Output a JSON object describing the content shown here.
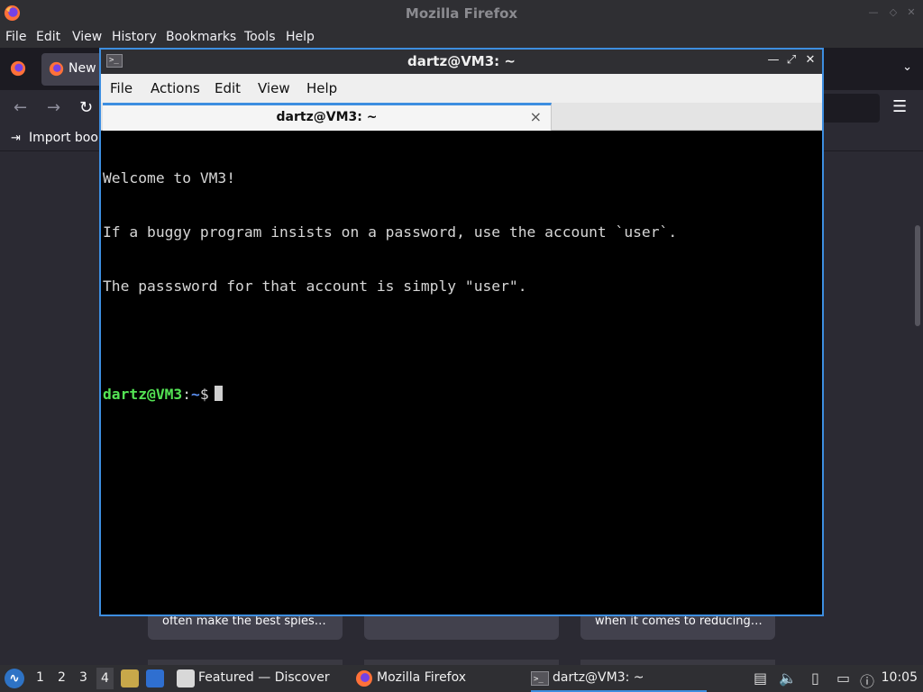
{
  "firefox": {
    "window_title": "Mozilla Firefox",
    "menu": [
      "File",
      "Edit",
      "View",
      "History",
      "Bookmarks",
      "Tools",
      "Help"
    ],
    "tab_label": "New",
    "bookmarks_label": "Import book",
    "cards": [
      {
        "text": "often make the best spies…"
      },
      {
        "text": ""
      },
      {
        "text": "when it comes to reducing…"
      }
    ]
  },
  "terminal": {
    "window_title": "dartz@VM3: ~",
    "menu": [
      "File",
      "Actions",
      "Edit",
      "View",
      "Help"
    ],
    "tab_label": "dartz@VM3: ~",
    "tab_close": "×",
    "output": [
      "Welcome to VM3!",
      "If a buggy program insists on a password, use the account `user`.",
      "The passsword for that account is simply \"user\".",
      ""
    ],
    "prompt": {
      "user_host": "dartz@VM3",
      "sep": ":",
      "path": "~",
      "symbol": "$"
    }
  },
  "taskbar": {
    "workspaces": [
      "1",
      "2",
      "3",
      "4"
    ],
    "active_workspace": "4",
    "tasks": [
      {
        "label": "Featured — Discover",
        "icon": "discover-icon"
      },
      {
        "label": "Mozilla Firefox",
        "icon": "firefox-icon"
      },
      {
        "label": "dartz@VM3: ~",
        "icon": "terminal-icon",
        "active": true
      }
    ],
    "clock": "10:05"
  },
  "colors": {
    "accent": "#3d8ee0",
    "prompt_user": "#54e354",
    "prompt_path": "#5b8ff0",
    "terminal_bg": "#000000",
    "terminal_fg": "#d6d6d6"
  }
}
